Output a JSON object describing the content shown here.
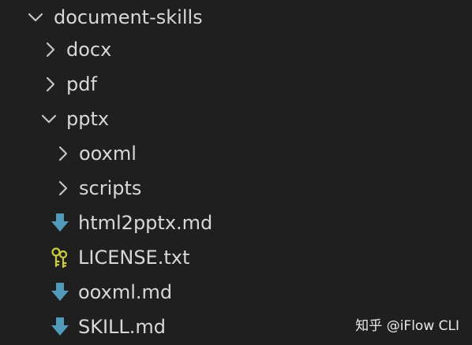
{
  "explorer": {
    "items": [
      {
        "label": "document-skills",
        "type": "folder",
        "expanded": true,
        "depth": 0
      },
      {
        "label": "docx",
        "type": "folder",
        "expanded": false,
        "depth": 1
      },
      {
        "label": "pdf",
        "type": "folder",
        "expanded": false,
        "depth": 1
      },
      {
        "label": "pptx",
        "type": "folder",
        "expanded": true,
        "depth": 1
      },
      {
        "label": "ooxml",
        "type": "folder",
        "expanded": false,
        "depth": 2
      },
      {
        "label": "scripts",
        "type": "folder",
        "expanded": false,
        "depth": 2
      },
      {
        "label": "html2pptx.md",
        "type": "file",
        "icon": "markdown-download-icon",
        "depth": 2
      },
      {
        "label": "LICENSE.txt",
        "type": "file",
        "icon": "license-key-icon",
        "depth": 2
      },
      {
        "label": "ooxml.md",
        "type": "file",
        "icon": "markdown-download-icon",
        "depth": 2
      },
      {
        "label": "SKILL.md",
        "type": "file",
        "icon": "markdown-download-icon",
        "depth": 2
      }
    ]
  },
  "watermark": {
    "text": "知乎 @iFlow CLI"
  },
  "colors": {
    "background": "#1f1f1f",
    "text": "#d8d8d8",
    "chevron": "#c5c5c5",
    "markdown_icon": "#519aba",
    "license_icon": "#cbcb41"
  }
}
